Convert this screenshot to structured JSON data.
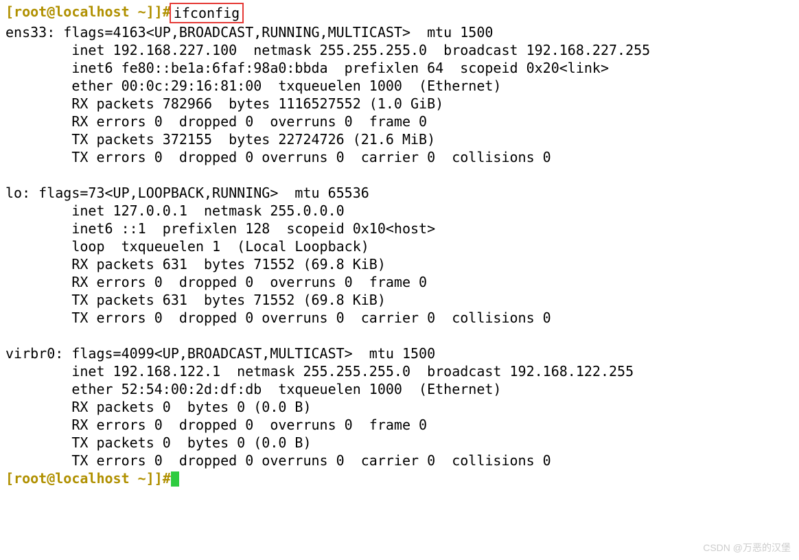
{
  "prompt1": {
    "user_host": "[root@localhost ~]]#",
    "command": "ifconfig"
  },
  "interfaces": [
    {
      "name": "ens33",
      "flags_line": "flags=4163<UP,BROADCAST,RUNNING,MULTICAST>  mtu 1500",
      "lines": [
        "inet 192.168.227.100  netmask 255.255.255.0  broadcast 192.168.227.255",
        "inet6 fe80::be1a:6faf:98a0:bbda  prefixlen 64  scopeid 0x20<link>",
        "ether 00:0c:29:16:81:00  txqueuelen 1000  (Ethernet)",
        "RX packets 782966  bytes 1116527552 (1.0 GiB)",
        "RX errors 0  dropped 0  overruns 0  frame 0",
        "TX packets 372155  bytes 22724726 (21.6 MiB)",
        "TX errors 0  dropped 0 overruns 0  carrier 0  collisions 0"
      ]
    },
    {
      "name": "lo",
      "flags_line": "flags=73<UP,LOOPBACK,RUNNING>  mtu 65536",
      "lines": [
        "inet 127.0.0.1  netmask 255.0.0.0",
        "inet6 ::1  prefixlen 128  scopeid 0x10<host>",
        "loop  txqueuelen 1  (Local Loopback)",
        "RX packets 631  bytes 71552 (69.8 KiB)",
        "RX errors 0  dropped 0  overruns 0  frame 0",
        "TX packets 631  bytes 71552 (69.8 KiB)",
        "TX errors 0  dropped 0 overruns 0  carrier 0  collisions 0"
      ]
    },
    {
      "name": "virbr0",
      "flags_line": "flags=4099<UP,BROADCAST,MULTICAST>  mtu 1500",
      "lines": [
        "inet 192.168.122.1  netmask 255.255.255.0  broadcast 192.168.122.255",
        "ether 52:54:00:2d:df:db  txqueuelen 1000  (Ethernet)",
        "RX packets 0  bytes 0 (0.0 B)",
        "RX errors 0  dropped 0  overruns 0  frame 0",
        "TX packets 0  bytes 0 (0.0 B)",
        "TX errors 0  dropped 0 overruns 0  carrier 0  collisions 0"
      ]
    }
  ],
  "prompt2": {
    "user_host": "[root@localhost ~]]#"
  },
  "watermark": "CSDN @万恶的汉堡"
}
